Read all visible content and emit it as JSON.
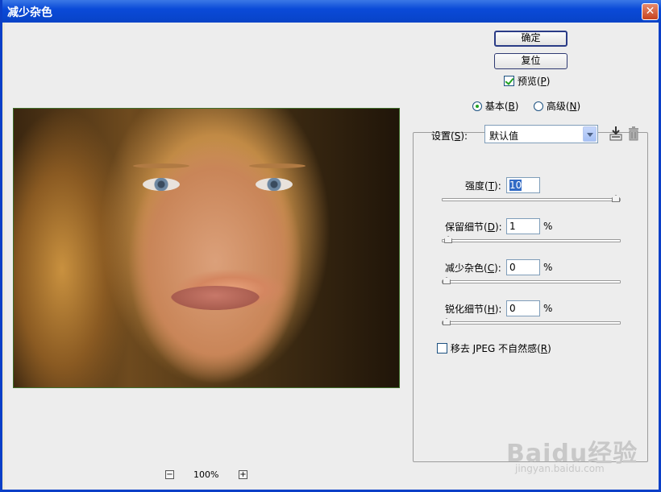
{
  "window": {
    "title": "减少杂色",
    "close_glyph": "✕"
  },
  "buttons": {
    "ok": "确定",
    "reset": "复位"
  },
  "preview_toggle": {
    "label": "预览(",
    "key": "P",
    "suffix": ")",
    "checked": true
  },
  "mode": {
    "basic": {
      "label": "基本(",
      "key": "B",
      "suffix": ")",
      "selected": true
    },
    "advanced": {
      "label": "高级(",
      "key": "N",
      "suffix": ")",
      "selected": false
    }
  },
  "settings": {
    "label": "设置(",
    "key": "S",
    "suffix": "):",
    "value": "默认值",
    "save_icon": "save-preset-icon",
    "delete_icon": "trash-icon"
  },
  "sliders": [
    {
      "label": "强度(",
      "key": "T",
      "suffix": "):",
      "value": "10",
      "unit": "",
      "fraction": 1.0
    },
    {
      "label": "保留细节(",
      "key": "D",
      "suffix": "):",
      "value": "1",
      "unit": "%",
      "fraction": 0.01
    },
    {
      "label": "减少杂色(",
      "key": "C",
      "suffix": "):",
      "value": "0",
      "unit": "%",
      "fraction": 0.0
    },
    {
      "label": "锐化细节(",
      "key": "H",
      "suffix": "):",
      "value": "0",
      "unit": "%",
      "fraction": 0.0
    }
  ],
  "jpeg": {
    "label": "移去 JPEG 不自然感(",
    "key": "R",
    "suffix": ")",
    "checked": false
  },
  "zoom": {
    "minus": "−",
    "plus": "+",
    "level": "100%"
  },
  "watermark": {
    "main": "Baidu经验",
    "sub": "jingyan.baidu.com"
  },
  "colors": {
    "titlebar": "#0a4ad8",
    "check_accent": "#21a121",
    "selection": "#316ac5"
  }
}
